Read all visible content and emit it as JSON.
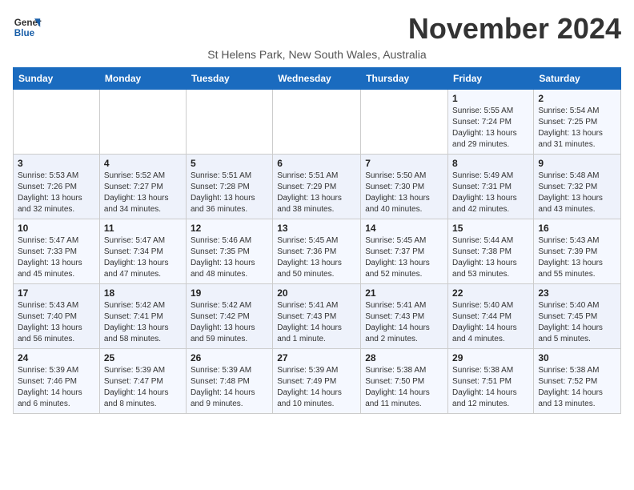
{
  "logo": {
    "line1": "General",
    "line2": "Blue"
  },
  "title": "November 2024",
  "subtitle": "St Helens Park, New South Wales, Australia",
  "days_header": [
    "Sunday",
    "Monday",
    "Tuesday",
    "Wednesday",
    "Thursday",
    "Friday",
    "Saturday"
  ],
  "weeks": [
    [
      {
        "day": "",
        "info": ""
      },
      {
        "day": "",
        "info": ""
      },
      {
        "day": "",
        "info": ""
      },
      {
        "day": "",
        "info": ""
      },
      {
        "day": "",
        "info": ""
      },
      {
        "day": "1",
        "info": "Sunrise: 5:55 AM\nSunset: 7:24 PM\nDaylight: 13 hours\nand 29 minutes."
      },
      {
        "day": "2",
        "info": "Sunrise: 5:54 AM\nSunset: 7:25 PM\nDaylight: 13 hours\nand 31 minutes."
      }
    ],
    [
      {
        "day": "3",
        "info": "Sunrise: 5:53 AM\nSunset: 7:26 PM\nDaylight: 13 hours\nand 32 minutes."
      },
      {
        "day": "4",
        "info": "Sunrise: 5:52 AM\nSunset: 7:27 PM\nDaylight: 13 hours\nand 34 minutes."
      },
      {
        "day": "5",
        "info": "Sunrise: 5:51 AM\nSunset: 7:28 PM\nDaylight: 13 hours\nand 36 minutes."
      },
      {
        "day": "6",
        "info": "Sunrise: 5:51 AM\nSunset: 7:29 PM\nDaylight: 13 hours\nand 38 minutes."
      },
      {
        "day": "7",
        "info": "Sunrise: 5:50 AM\nSunset: 7:30 PM\nDaylight: 13 hours\nand 40 minutes."
      },
      {
        "day": "8",
        "info": "Sunrise: 5:49 AM\nSunset: 7:31 PM\nDaylight: 13 hours\nand 42 minutes."
      },
      {
        "day": "9",
        "info": "Sunrise: 5:48 AM\nSunset: 7:32 PM\nDaylight: 13 hours\nand 43 minutes."
      }
    ],
    [
      {
        "day": "10",
        "info": "Sunrise: 5:47 AM\nSunset: 7:33 PM\nDaylight: 13 hours\nand 45 minutes."
      },
      {
        "day": "11",
        "info": "Sunrise: 5:47 AM\nSunset: 7:34 PM\nDaylight: 13 hours\nand 47 minutes."
      },
      {
        "day": "12",
        "info": "Sunrise: 5:46 AM\nSunset: 7:35 PM\nDaylight: 13 hours\nand 48 minutes."
      },
      {
        "day": "13",
        "info": "Sunrise: 5:45 AM\nSunset: 7:36 PM\nDaylight: 13 hours\nand 50 minutes."
      },
      {
        "day": "14",
        "info": "Sunrise: 5:45 AM\nSunset: 7:37 PM\nDaylight: 13 hours\nand 52 minutes."
      },
      {
        "day": "15",
        "info": "Sunrise: 5:44 AM\nSunset: 7:38 PM\nDaylight: 13 hours\nand 53 minutes."
      },
      {
        "day": "16",
        "info": "Sunrise: 5:43 AM\nSunset: 7:39 PM\nDaylight: 13 hours\nand 55 minutes."
      }
    ],
    [
      {
        "day": "17",
        "info": "Sunrise: 5:43 AM\nSunset: 7:40 PM\nDaylight: 13 hours\nand 56 minutes."
      },
      {
        "day": "18",
        "info": "Sunrise: 5:42 AM\nSunset: 7:41 PM\nDaylight: 13 hours\nand 58 minutes."
      },
      {
        "day": "19",
        "info": "Sunrise: 5:42 AM\nSunset: 7:42 PM\nDaylight: 13 hours\nand 59 minutes."
      },
      {
        "day": "20",
        "info": "Sunrise: 5:41 AM\nSunset: 7:43 PM\nDaylight: 14 hours\nand 1 minute."
      },
      {
        "day": "21",
        "info": "Sunrise: 5:41 AM\nSunset: 7:43 PM\nDaylight: 14 hours\nand 2 minutes."
      },
      {
        "day": "22",
        "info": "Sunrise: 5:40 AM\nSunset: 7:44 PM\nDaylight: 14 hours\nand 4 minutes."
      },
      {
        "day": "23",
        "info": "Sunrise: 5:40 AM\nSunset: 7:45 PM\nDaylight: 14 hours\nand 5 minutes."
      }
    ],
    [
      {
        "day": "24",
        "info": "Sunrise: 5:39 AM\nSunset: 7:46 PM\nDaylight: 14 hours\nand 6 minutes."
      },
      {
        "day": "25",
        "info": "Sunrise: 5:39 AM\nSunset: 7:47 PM\nDaylight: 14 hours\nand 8 minutes."
      },
      {
        "day": "26",
        "info": "Sunrise: 5:39 AM\nSunset: 7:48 PM\nDaylight: 14 hours\nand 9 minutes."
      },
      {
        "day": "27",
        "info": "Sunrise: 5:39 AM\nSunset: 7:49 PM\nDaylight: 14 hours\nand 10 minutes."
      },
      {
        "day": "28",
        "info": "Sunrise: 5:38 AM\nSunset: 7:50 PM\nDaylight: 14 hours\nand 11 minutes."
      },
      {
        "day": "29",
        "info": "Sunrise: 5:38 AM\nSunset: 7:51 PM\nDaylight: 14 hours\nand 12 minutes."
      },
      {
        "day": "30",
        "info": "Sunrise: 5:38 AM\nSunset: 7:52 PM\nDaylight: 14 hours\nand 13 minutes."
      }
    ]
  ]
}
